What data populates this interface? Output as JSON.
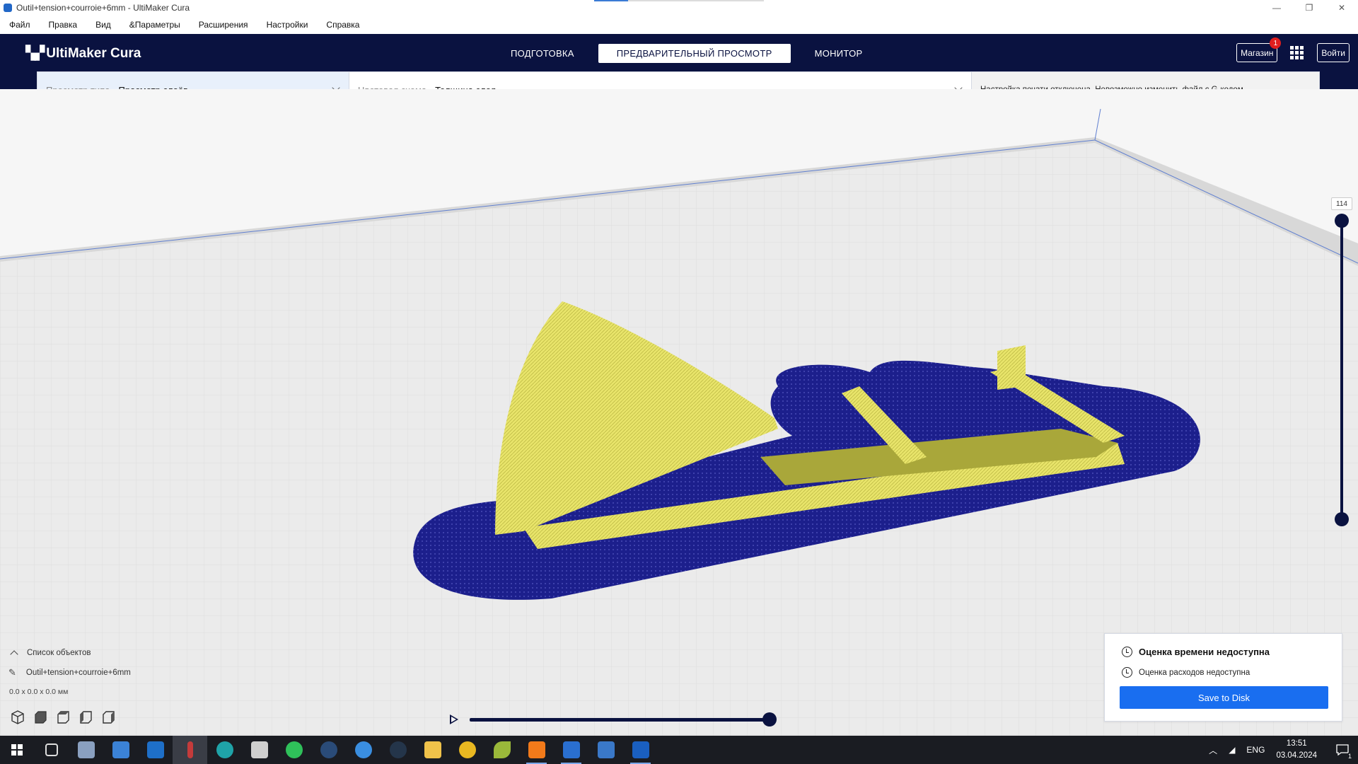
{
  "window": {
    "title": "Outil+tension+courroie+6mm - UltiMaker Cura",
    "controls": [
      "—",
      "❐",
      "✕"
    ]
  },
  "menu": [
    "Файл",
    "Правка",
    "Вид",
    "&Параметры",
    "Расширения",
    "Настройки",
    "Справка"
  ],
  "header": {
    "logo": "UltiMaker Cura",
    "tabs": [
      {
        "label": "ПОДГОТОВКА",
        "active": false
      },
      {
        "label": "ПРЕДВАРИТЕЛЬНЫЙ ПРОСМОТР",
        "active": true
      },
      {
        "label": "МОНИТОР",
        "active": false
      }
    ],
    "marketplace_label": "Магазин",
    "marketplace_badge": "1",
    "signin_label": "Войти"
  },
  "view_settings": {
    "view_type_label": "Просмотр типа",
    "view_type_value": "Просмотр слоёв",
    "color_scheme_label": "Цветовая схема",
    "color_scheme_value": "Толщина слоя",
    "message": "Настройка печати отключена. Невозможно изменить файл с G-кодом."
  },
  "layer_slider": {
    "value": "114",
    "fraction": 1.0
  },
  "object_list": {
    "header": "Список объектов",
    "item": "Outil+tension+courroie+6mm",
    "dimensions": "0.0 x 0.0 x 0.0 мм"
  },
  "simulation": {
    "progress": 1.0
  },
  "action_panel": {
    "time_estimate": "Оценка времени недоступна",
    "cost_estimate": "Оценка расходов недоступна",
    "save_button": "Save to Disk"
  },
  "colors": {
    "header_bg": "#0a1240",
    "accent_blue": "#196ef0",
    "model_yellow": "#e8e46a",
    "raft_blue": "#1c1f8c"
  },
  "taskbar": {
    "apps": [
      "task-view-icon",
      "explorer-app-icon",
      "store-icon",
      "mail-icon",
      "app-red-icon",
      "edge-icon",
      "calculator-icon",
      "whatsapp-icon",
      "steam-icon",
      "thunderbird-icon",
      "app-dark-icon",
      "file-explorer-icon",
      "sun-app-icon",
      "leaf-app-icon",
      "fusion-icon",
      "cura-icon",
      "7zip-icon",
      "cura-running-icon"
    ],
    "tray_language": "ENG",
    "time": "13:51",
    "date": "03.04.2024",
    "notification_count": "1"
  }
}
